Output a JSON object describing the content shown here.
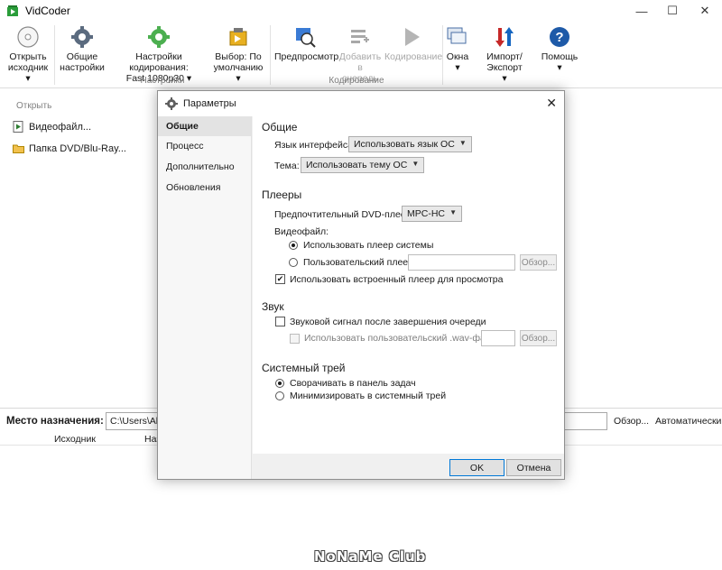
{
  "window": {
    "title": "VidCoder",
    "minimize": "—",
    "maximize": "☐",
    "close": "✕"
  },
  "ribbon": {
    "open_source": [
      "Открыть",
      "исходник ▾"
    ],
    "general_settings": [
      "Общие",
      "настройки"
    ],
    "encoding_settings": [
      "Настройки кодирования:",
      "Fast 1080p30 ▾"
    ],
    "choice": [
      "Выбор: По",
      "умолчанию ▾"
    ],
    "preview": "Предпросмотр",
    "add_to_queue": [
      "Добавить в",
      "очередь"
    ],
    "encoding": "Кодирование",
    "windows": [
      "Окна",
      "▾"
    ],
    "import_export": [
      "Импорт/Экспорт",
      "▾"
    ],
    "help": [
      "Помощь",
      "▾"
    ],
    "group_settings": "Настройки",
    "group_encoding": "Кодирование"
  },
  "left_panel": {
    "header": "Открыть",
    "video_file": "Видеофайл...",
    "dvd_folder": "Папка DVD/Blu-Ray..."
  },
  "destination": {
    "label": "Место назначения:",
    "path": "C:\\Users\\Ale",
    "browse": "Обзор...",
    "auto": "Автоматически"
  },
  "queue": {
    "columns": [
      "Исходник",
      "Наз"
    ]
  },
  "watermark": "NoNaMe Club",
  "dialog": {
    "title": "Параметры",
    "close": "✕",
    "nav": [
      "Общие",
      "Процесс",
      "Дополнительно",
      "Обновления"
    ],
    "general": {
      "title": "Общие",
      "language_label": "Язык интерфейса:",
      "language_value": "Использовать язык ОС",
      "theme_label": "Тема:",
      "theme_value": "Использовать тему ОС"
    },
    "players": {
      "title": "Плееры",
      "dvd_label": "Предпочтительный DVD-плеер:",
      "dvd_value": "MPC-HC",
      "videofile_label": "Видеофайл:",
      "system_player": "Использовать плеер системы",
      "custom_player": "Пользовательский плеер:",
      "browse": "Обзор...",
      "builtin_player": "Использовать встроенный плеер для просмотра"
    },
    "sound": {
      "title": "Звук",
      "beep": "Звуковой сигнал после завершения очереди",
      "custom_wav": "Использовать пользовательский .wav-файл:",
      "browse": "Обзор..."
    },
    "tray": {
      "title": "Системный трей",
      "to_taskbar": "Сворачивать в панель задач",
      "to_tray": "Минимизировать в системный трей"
    },
    "ok": "OK",
    "cancel": "Отмена"
  }
}
